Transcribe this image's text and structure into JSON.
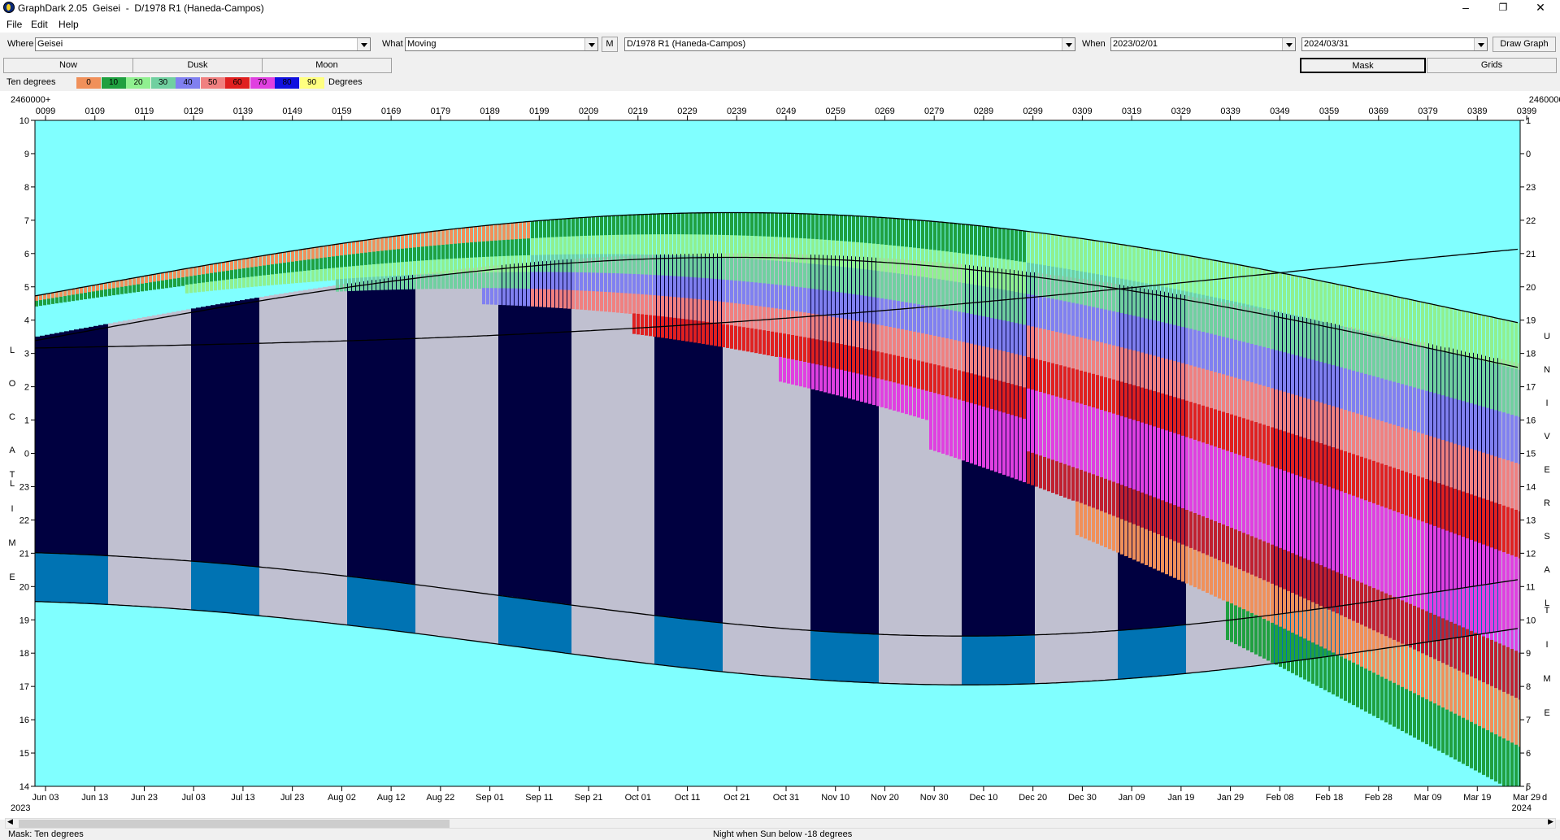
{
  "window": {
    "title": "GraphDark 2.05  Geisei  -  D/1978 R1 (Haneda-Campos)",
    "minimize": "–",
    "maximize": "❐",
    "close": "✕"
  },
  "menu": {
    "file": "File",
    "edit": "Edit",
    "help": "Help"
  },
  "toolbar": {
    "where_label": "Where",
    "where_value": "Geisei",
    "what_label": "What",
    "what_value": "Moving",
    "m_button": "M",
    "object_value": "D/1978 R1 (Haneda-Campos)",
    "when_label": "When",
    "start_date": "2023/02/01",
    "end_date": "2024/03/31",
    "draw_button": "Draw Graph"
  },
  "tabs": {
    "now": "Now",
    "dusk": "Dusk",
    "moon": "Moon",
    "mask": "Mask",
    "grids": "Grids"
  },
  "legend": {
    "title": "Ten degrees",
    "labels": [
      "0",
      "10",
      "20",
      "30",
      "40",
      "50",
      "60",
      "70",
      "80",
      "90"
    ],
    "colors": [
      "#f0905a",
      "#20a040",
      "#90f090",
      "#70d0a0",
      "#8080f0",
      "#f08080",
      "#e02020",
      "#e040e0",
      "#1010e0",
      "#ffff80"
    ],
    "units": "Degrees"
  },
  "chart_data": {
    "type": "heatmap",
    "julian_prefix": "2460000+",
    "jd_ticks": [
      "0099",
      "0109",
      "0119",
      "0129",
      "0139",
      "0149",
      "0159",
      "0169",
      "0179",
      "0189",
      "0199",
      "0209",
      "0219",
      "0229",
      "0239",
      "0249",
      "0259",
      "0269",
      "0279",
      "0289",
      "0299",
      "0309",
      "0319",
      "0329",
      "0339",
      "0349",
      "0359",
      "0369",
      "0379",
      "0389",
      "0399"
    ],
    "date_ticks": [
      "Jun 03",
      "Jun 13",
      "Jun 23",
      "Jul 03",
      "Jul 13",
      "Jul 23",
      "Aug 02",
      "Aug 12",
      "Aug 22",
      "Sep 01",
      "Sep 11",
      "Sep 21",
      "Oct 01",
      "Oct 11",
      "Oct 21",
      "Oct 31",
      "Nov 10",
      "Nov 20",
      "Nov 30",
      "Dec 10",
      "Dec 20",
      "Dec 30",
      "Jan 09",
      "Jan 19",
      "Jan 29",
      "Feb 08",
      "Feb 18",
      "Feb 28",
      "Mar 09",
      "Mar 19",
      "Mar 29"
    ],
    "year_start": "2023",
    "year_end": "2024",
    "x_unit": "d",
    "local_ticks": [
      "10",
      "9",
      "8",
      "7",
      "6",
      "5",
      "4",
      "3",
      "2",
      "1",
      "0",
      "23",
      "22",
      "21",
      "20",
      "19",
      "18",
      "17",
      "16",
      "15",
      "14"
    ],
    "ut_ticks": [
      "1",
      "0",
      "23",
      "22",
      "21",
      "20",
      "19",
      "18",
      "17",
      "16",
      "15",
      "14",
      "13",
      "12",
      "11",
      "10",
      "9",
      "8",
      "7",
      "6",
      "5"
    ],
    "left_axis_label": "LOCAL TIME",
    "right_axis_label": "UNIVERSAL TIME",
    "colors": {
      "day": "#80ffff",
      "night": "#000040",
      "twilight": "#0080c0",
      "moonlit": "#c0c0d0"
    }
  },
  "status": {
    "mask": "Mask:  Ten degrees",
    "night": "Night when Sun below -18 degrees"
  }
}
